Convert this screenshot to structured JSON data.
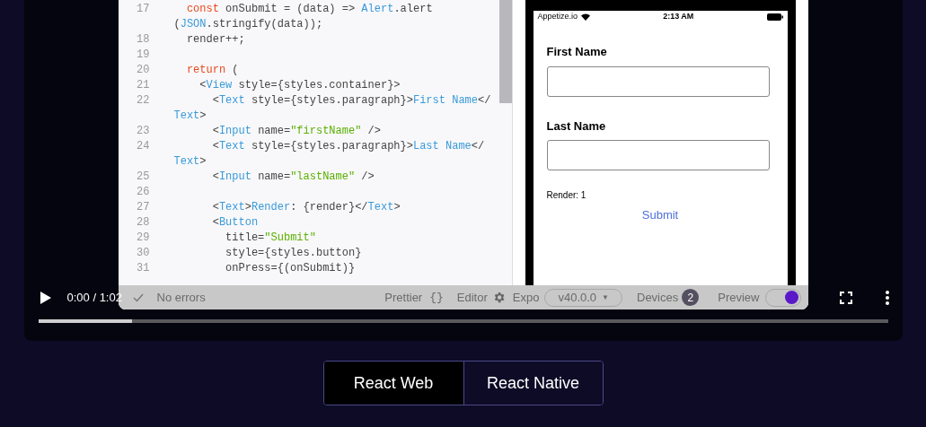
{
  "video": {
    "time": "0:00 / 1:02",
    "level": 0.11,
    "playing": false
  },
  "editor": {
    "lines": [
      {
        "number": "17",
        "rows": [
          [
            {
              "kind": "plain",
              "text": "  "
            },
            {
              "kind": "keyword",
              "text": "const"
            },
            {
              "kind": "plain",
              "text": " onSubmit = (data) => "
            },
            {
              "kind": "tag",
              "text": "Alert"
            },
            {
              "kind": "plain",
              "text": ".alert"
            }
          ],
          [
            {
              "kind": "plain",
              "text": "("
            },
            {
              "kind": "tag",
              "text": "JSON"
            },
            {
              "kind": "plain",
              "text": ".stringify(data));"
            }
          ]
        ]
      },
      {
        "number": "18",
        "rows": [
          [
            {
              "kind": "plain",
              "text": "  render++;"
            }
          ]
        ]
      },
      {
        "number": "19",
        "rows": [
          []
        ]
      },
      {
        "number": "20",
        "rows": [
          [
            {
              "kind": "plain",
              "text": "  "
            },
            {
              "kind": "keyword",
              "text": "return"
            },
            {
              "kind": "plain",
              "text": " ("
            }
          ]
        ]
      },
      {
        "number": "21",
        "rows": [
          [
            {
              "kind": "plain",
              "text": "    <"
            },
            {
              "kind": "tag",
              "text": "View"
            },
            {
              "kind": "plain",
              "text": " style={styles.container}>"
            }
          ]
        ]
      },
      {
        "number": "22",
        "rows": [
          [
            {
              "kind": "plain",
              "text": "      <"
            },
            {
              "kind": "tag",
              "text": "Text"
            },
            {
              "kind": "plain",
              "text": " style={styles.paragraph}>"
            },
            {
              "kind": "tag",
              "text": "First Name"
            },
            {
              "kind": "plain",
              "text": "</"
            }
          ],
          [
            {
              "kind": "tag",
              "text": "Text"
            },
            {
              "kind": "plain",
              "text": ">"
            }
          ]
        ]
      },
      {
        "number": "23",
        "rows": [
          [
            {
              "kind": "plain",
              "text": "      <"
            },
            {
              "kind": "tag",
              "text": "Input"
            },
            {
              "kind": "plain",
              "text": " name="
            },
            {
              "kind": "string",
              "text": "\"firstName\""
            },
            {
              "kind": "plain",
              "text": " />"
            }
          ]
        ]
      },
      {
        "number": "24",
        "rows": [
          [
            {
              "kind": "plain",
              "text": "      <"
            },
            {
              "kind": "tag",
              "text": "Text"
            },
            {
              "kind": "plain",
              "text": " style={styles.paragraph}>"
            },
            {
              "kind": "tag",
              "text": "Last Name"
            },
            {
              "kind": "plain",
              "text": "</"
            }
          ],
          [
            {
              "kind": "tag",
              "text": "Text"
            },
            {
              "kind": "plain",
              "text": ">"
            }
          ]
        ]
      },
      {
        "number": "25",
        "rows": [
          [
            {
              "kind": "plain",
              "text": "      <"
            },
            {
              "kind": "tag",
              "text": "Input"
            },
            {
              "kind": "plain",
              "text": " name="
            },
            {
              "kind": "string",
              "text": "\"lastName\""
            },
            {
              "kind": "plain",
              "text": " />"
            }
          ]
        ]
      },
      {
        "number": "26",
        "rows": [
          []
        ]
      },
      {
        "number": "27",
        "rows": [
          [
            {
              "kind": "plain",
              "text": "      <"
            },
            {
              "kind": "tag",
              "text": "Text"
            },
            {
              "kind": "plain",
              "text": ">"
            },
            {
              "kind": "tag",
              "text": "Render"
            },
            {
              "kind": "plain",
              "text": ": {render}</"
            },
            {
              "kind": "tag",
              "text": "Text"
            },
            {
              "kind": "plain",
              "text": ">"
            }
          ]
        ]
      },
      {
        "number": "28",
        "rows": [
          [
            {
              "kind": "plain",
              "text": "      <"
            },
            {
              "kind": "tag",
              "text": "Button"
            }
          ]
        ]
      },
      {
        "number": "29",
        "rows": [
          [
            {
              "kind": "plain",
              "text": "        title="
            },
            {
              "kind": "string",
              "text": "\"Submit\""
            }
          ]
        ]
      },
      {
        "number": "30",
        "rows": [
          [
            {
              "kind": "plain",
              "text": "        style={styles.button}"
            }
          ]
        ]
      },
      {
        "number": "31",
        "rows": [
          [
            {
              "kind": "plain",
              "text": "        onPress={(onSubmit)}"
            }
          ]
        ]
      }
    ]
  },
  "status_bar": {
    "errors": "No errors",
    "prettier": "Prettier",
    "prettier_icon": "{}",
    "editor": "Editor",
    "expo": "Expo",
    "version": "v40.0.0",
    "version_caret": "▼",
    "devices": "Devices",
    "device_count": "2",
    "preview": "Preview",
    "preview_on": true
  },
  "phone": {
    "carrier": "Appetize.io",
    "time": "2:13 AM",
    "fields": [
      {
        "label": "First Name"
      },
      {
        "label": "Last Name"
      }
    ],
    "render": "Render: 1",
    "submit": "Submit"
  },
  "tabs": [
    {
      "label": "React Web",
      "selected": true
    },
    {
      "label": "React Native",
      "selected": false
    }
  ]
}
